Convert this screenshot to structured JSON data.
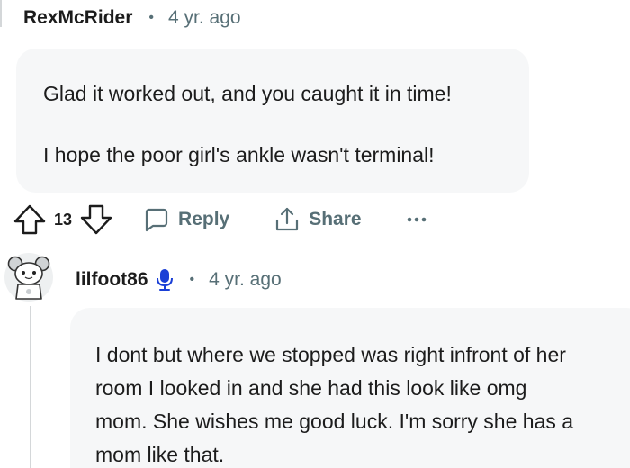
{
  "comments": [
    {
      "username": "RexMcRider",
      "separator": "•",
      "time": "4 yr. ago",
      "paragraphs": [
        "Glad it worked out, and you caught it in time!",
        "I hope the poor girl's ankle wasn't terminal!"
      ],
      "votes": "13",
      "actions": {
        "reply": "Reply",
        "share": "Share",
        "more": "•••"
      }
    },
    {
      "username": "lilfoot86",
      "separator": "•",
      "time": "4 yr. ago",
      "badge_icon": "microphone-icon",
      "avatar_icon": "snoo-avatar",
      "lines": [
        "I dont but where we stopped was right infront of her",
        "room I looked in and she had this look like omg",
        "mom. She wishes me good luck. I'm sorry she has a",
        "mom like that."
      ]
    }
  ],
  "colors": {
    "bubble_bg": "#f6f7f8",
    "meta_text": "#576f76",
    "mic_blue": "#1a3fd6",
    "thread_line": "#d4d7d9"
  }
}
